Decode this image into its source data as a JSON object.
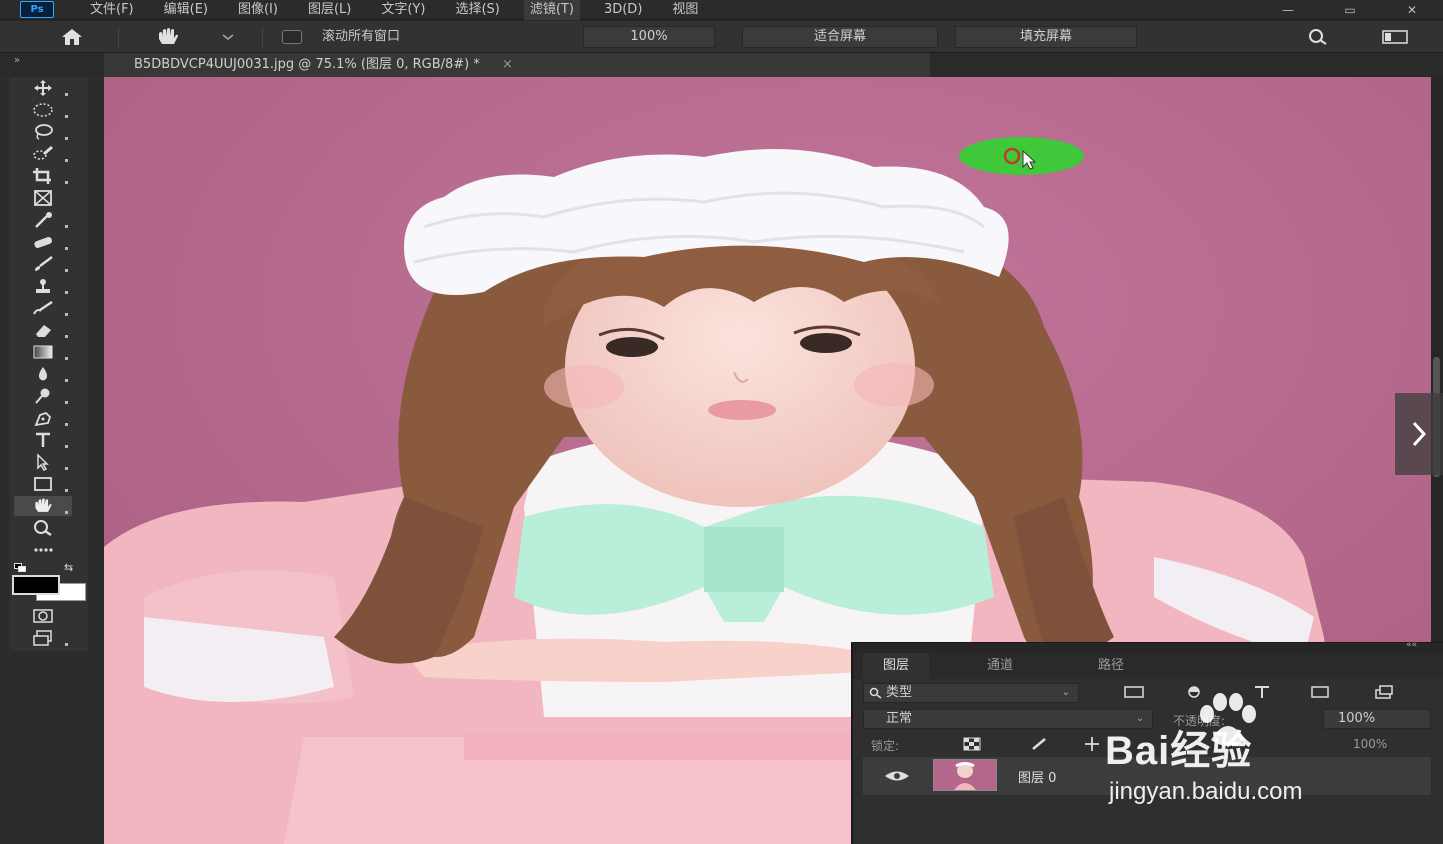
{
  "app": {
    "logo": "Ps"
  },
  "menu": [
    "文件(F)",
    "编辑(E)",
    "图像(I)",
    "图层(L)",
    "文字(Y)",
    "选择(S)",
    "滤镜(T)",
    "3D(D)",
    "视图"
  ],
  "menu_active_index": 6,
  "window_controls": {
    "minimize": "—",
    "restore": "▭",
    "close": "✕"
  },
  "options_bar": {
    "scroll_all_label": "滚动所有窗口",
    "zoom_value": "100%",
    "fit_screen": "适合屏幕",
    "fill_screen": "填充屏幕"
  },
  "tab": {
    "collapse": "»",
    "title": "B5DBDVCP4UUJ0031.jpg @ 75.1% (图层 0, RGB/8#) *",
    "close": "×"
  },
  "icons": {
    "home": "home-icon",
    "hand": "hand-icon",
    "search": "search-icon",
    "workspace": "workspace-icon",
    "next": "chevron-right-icon"
  },
  "colors": {
    "canvas_bg": "#b3678a",
    "zoom_indicator": "#3fc93a",
    "foreground": "#000000",
    "background": "#ffffff"
  },
  "layers_panel": {
    "tabs": [
      "图层",
      "通道",
      "路径"
    ],
    "active_tab": 0,
    "collapse": "««",
    "filter_label": "类型",
    "blend_mode": "正常",
    "opacity_label": "不透明度:",
    "opacity_value": "100%",
    "lock_label": "锁定:",
    "fill_value": "100%",
    "layer_name": "图层 0"
  },
  "watermark": {
    "brand": "Bai经验",
    "url": "jingyan.baidu.com"
  }
}
